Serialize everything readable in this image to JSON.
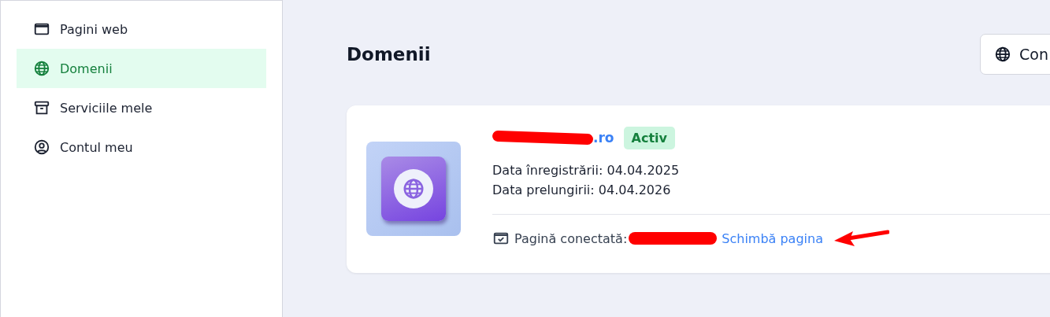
{
  "sidebar": {
    "items": [
      {
        "label": "Pagini web",
        "selected": false
      },
      {
        "label": "Domenii",
        "selected": true
      },
      {
        "label": "Serviciile mele",
        "selected": false
      },
      {
        "label": "Contul meu",
        "selected": false
      }
    ]
  },
  "page": {
    "title": "Domenii",
    "action_button": "Con"
  },
  "domain": {
    "name": ".ro",
    "name_redacted": true,
    "status": "Activ",
    "registered": "Data înregistrării: 04.04.2025",
    "renewal": "Data prelungirii: 04.04.2026",
    "connected_label": "Pagină conectată:",
    "connected_redacted": true,
    "change_link": "Schimbă pagina",
    "annotation_arrow": true
  }
}
